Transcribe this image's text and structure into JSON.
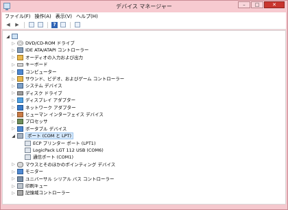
{
  "window": {
    "title": "デバイス マネージャー",
    "buttons": {
      "minimize": "–",
      "maximize": "□",
      "close": "✕"
    }
  },
  "menu": [
    "ファイル(F)",
    "操作(A)",
    "表示(V)",
    "ヘルプ(H)"
  ],
  "toolbar": {
    "back": "◀",
    "forward": "▶",
    "help": "?"
  },
  "tree": {
    "root_expander": "◢",
    "items": [
      {
        "label": "DVD/CD-ROM ドライブ",
        "icon": "disc-drive-icon"
      },
      {
        "label": "IDE ATA/ATAPI コントローラー",
        "icon": "ide-controller-icon"
      },
      {
        "label": "オーディオの入力および出力",
        "icon": "audio-icon"
      },
      {
        "label": "キーボード",
        "icon": "keyboard-icon"
      },
      {
        "label": "コンピューター",
        "icon": "computer-icon"
      },
      {
        "label": "サウンド、ビデオ、およびゲーム コントローラー",
        "icon": "sound-video-icon"
      },
      {
        "label": "システム デバイス",
        "icon": "system-devices-icon"
      },
      {
        "label": "ディスク ドライブ",
        "icon": "disk-drive-icon"
      },
      {
        "label": "ディスプレイ アダプター",
        "icon": "display-adapter-icon"
      },
      {
        "label": "ネットワーク アダプター",
        "icon": "network-adapter-icon"
      },
      {
        "label": "ヒューマン インターフェイス デバイス",
        "icon": "hid-icon"
      },
      {
        "label": "プロセッサ",
        "icon": "processor-icon"
      },
      {
        "label": "ポータブル デバイス",
        "icon": "portable-device-icon"
      },
      {
        "label": "ポート (COM と LPT)",
        "icon": "port-icon",
        "expanded": true
      },
      {
        "label": "ECP プリンター ポート (LPT1)",
        "icon": "port-device-icon",
        "child": true
      },
      {
        "label": "LogicPack LGT 112 USB (COM6)",
        "icon": "port-device-icon",
        "child": true
      },
      {
        "label": "通信ポート (COM1)",
        "icon": "port-device-icon",
        "child": true
      },
      {
        "label": "マウスとそのほかのポインティング デバイス",
        "icon": "mouse-icon"
      },
      {
        "label": "モニター",
        "icon": "monitor-icon"
      },
      {
        "label": "ユニバーサル シリアル バス コントローラー",
        "icon": "usb-controller-icon"
      },
      {
        "label": "印刷キュー",
        "icon": "print-queue-icon"
      },
      {
        "label": "記憶域コントローラー",
        "icon": "storage-controller-icon"
      }
    ],
    "collapsed_glyph": "▷",
    "expanded_glyph": "◢"
  }
}
